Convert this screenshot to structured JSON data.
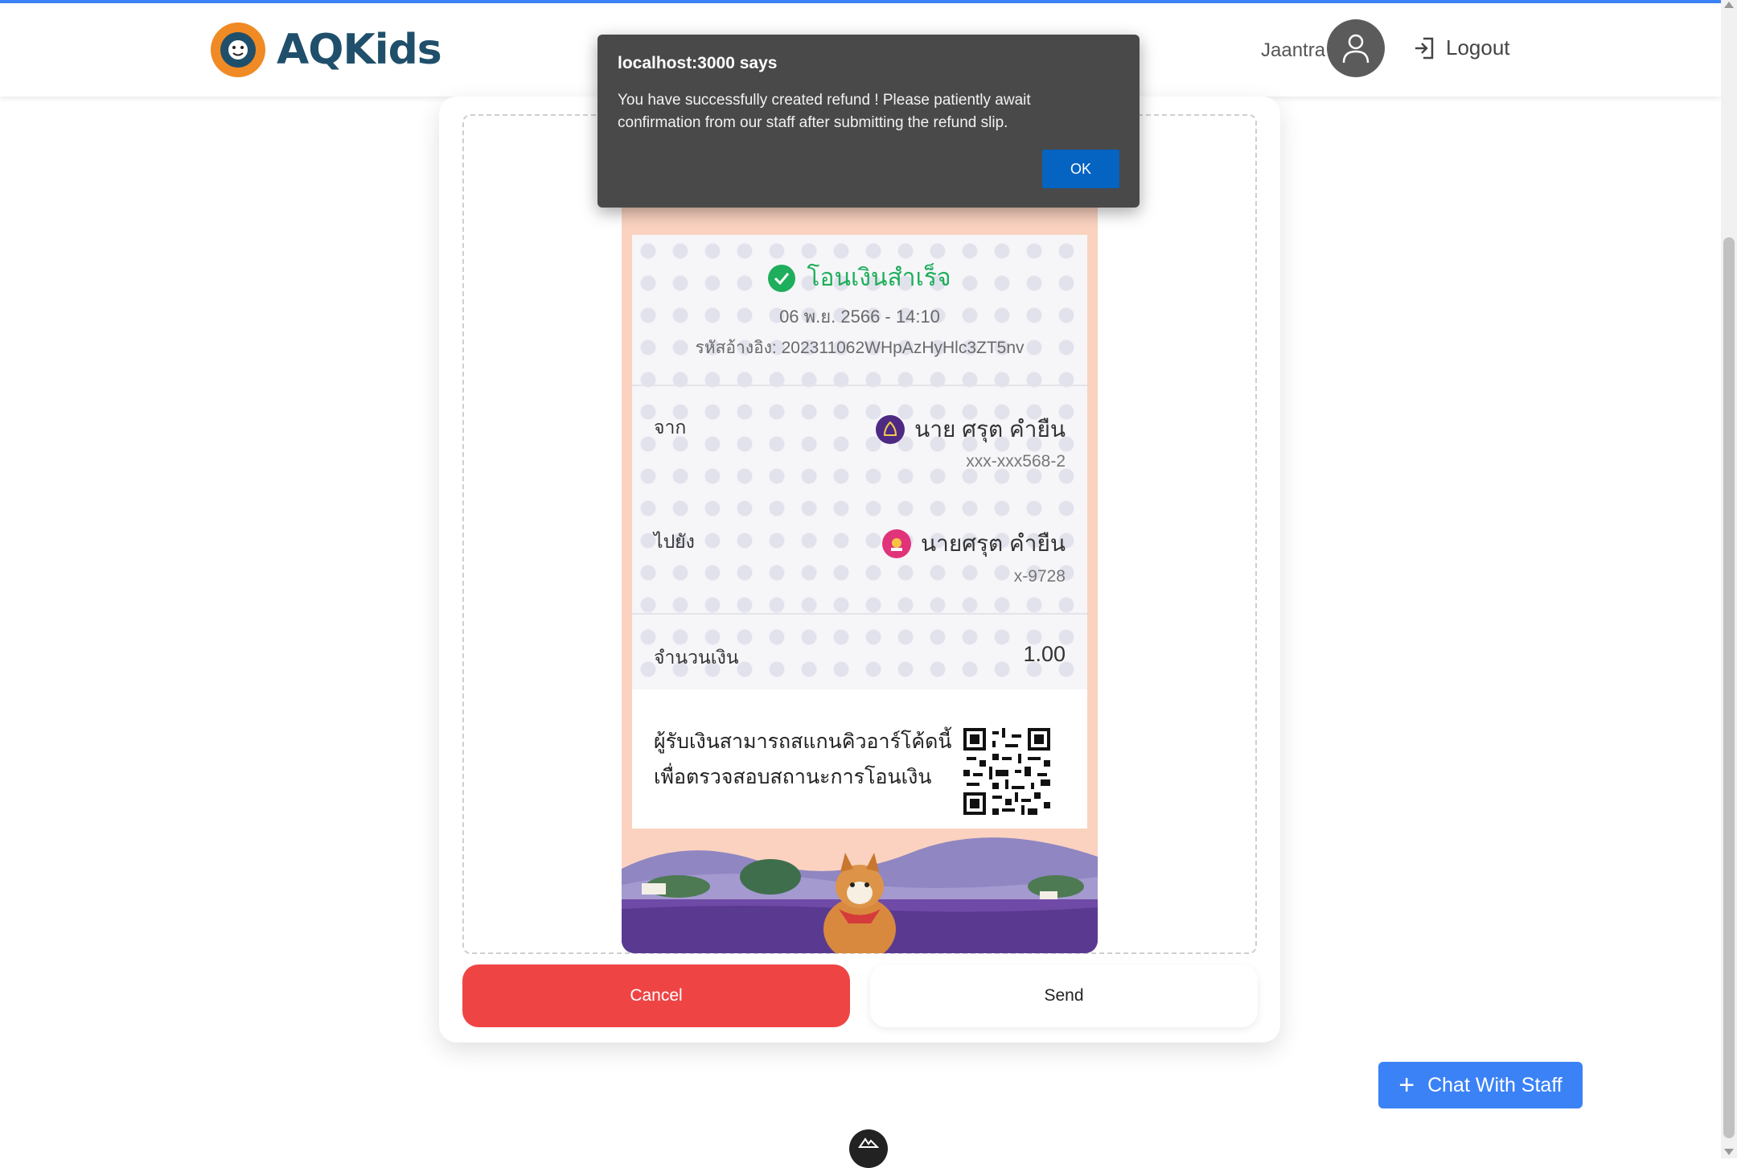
{
  "header": {
    "brand": "AQKids",
    "user_name": "Jaantra",
    "logout_label": "Logout"
  },
  "slip": {
    "status": "โอนเงินสำเร็จ",
    "datetime": "06 พ.ย. 2566 - 14:10",
    "reference": "รหัสอ้างอิง: 202311062WHpAzHyHlc3ZT5nv",
    "from_label": "จาก",
    "from_name": "นาย ศรุต คำยืน",
    "from_account": "xxx-xxx568-2",
    "to_label": "ไปยัง",
    "to_name": "นายศรุต คำยืน",
    "to_account": "x-9728",
    "amount_label": "จำนวนเงิน",
    "amount": "1.00",
    "qr_note": "ผู้รับเงินสามารถสแกนคิวอาร์โค้ดนี้ เพื่อตรวจสอบสถานะการโอนเงิน"
  },
  "actions": {
    "cancel_label": "Cancel",
    "send_label": "Send"
  },
  "chat": {
    "label": "Chat With Staff"
  },
  "dialog": {
    "title": "localhost:3000 says",
    "message": "You have successfully created refund ! Please patiently await confirmation from our staff after submitting the refund slip.",
    "ok_label": "OK"
  },
  "colors": {
    "accent": "#3b82f6",
    "cancel": "#ef4444",
    "success": "#1fae5b",
    "brand_text": "#1f4f6b"
  }
}
